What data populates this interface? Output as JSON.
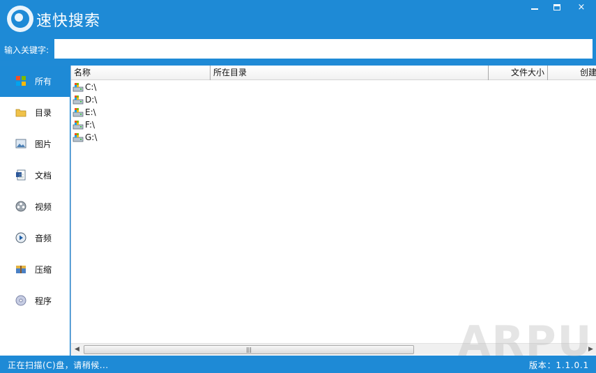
{
  "app": {
    "title": "速快搜索"
  },
  "window_controls": {
    "minimize": "minimize",
    "maximize": "maximize",
    "close": "×"
  },
  "search": {
    "label": "输入关键字:",
    "value": "",
    "placeholder": ""
  },
  "sidebar": {
    "items": [
      {
        "label": "所有",
        "icon": "all-icon",
        "active": true
      },
      {
        "label": "目录",
        "icon": "folder-icon",
        "active": false
      },
      {
        "label": "图片",
        "icon": "image-icon",
        "active": false
      },
      {
        "label": "文档",
        "icon": "document-icon",
        "active": false
      },
      {
        "label": "视频",
        "icon": "video-icon",
        "active": false
      },
      {
        "label": "音频",
        "icon": "audio-icon",
        "active": false
      },
      {
        "label": "压缩",
        "icon": "archive-icon",
        "active": false
      },
      {
        "label": "程序",
        "icon": "program-icon",
        "active": false
      }
    ]
  },
  "filelist": {
    "columns": [
      "名称",
      "所在目录",
      "文件大小",
      "创建"
    ],
    "rows": [
      {
        "name": "C:\\"
      },
      {
        "name": "D:\\"
      },
      {
        "name": "E:\\"
      },
      {
        "name": "F:\\"
      },
      {
        "name": "G:\\"
      }
    ],
    "scrollbar": {
      "left": "◀",
      "thumb": "|||",
      "right": "▶"
    }
  },
  "status": {
    "text": "正在扫描(C)盘，请稍候...",
    "version": "版本：1.1.0.1"
  },
  "watermark": "ARPUN",
  "colors": {
    "accent": "#1e8ad6",
    "panel": "#ffffff"
  }
}
